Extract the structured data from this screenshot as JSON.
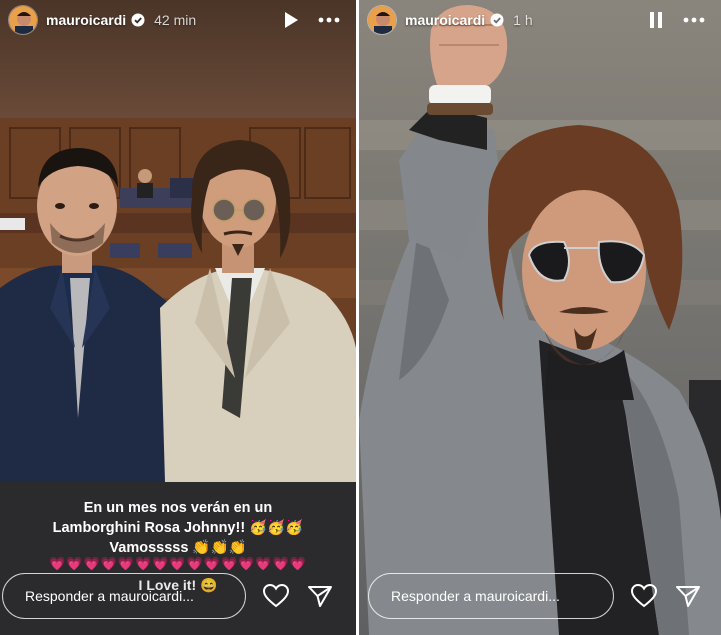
{
  "left_story": {
    "username": "mauroicardi",
    "time": "42 min",
    "caption_lines": [
      "En un mes nos verán en un",
      "Lamborghini Rosa Johnny!! 🥳🥳🥳",
      "Vamosssss 👏👏👏"
    ],
    "hearts": "💗💗💗💗💗💗💗💗💗💗💗💗💗💗💗",
    "tail_text": "I Love it! 😄",
    "reply_placeholder": "Responder a mauroicardi...",
    "icons": [
      "verified-badge-icon",
      "play-icon",
      "more-icon",
      "heart-icon",
      "send-icon"
    ]
  },
  "right_story": {
    "username": "mauroicardi",
    "time": "1 h",
    "reply_placeholder": "Responder a mauroicardi...",
    "icons": [
      "verified-badge-icon",
      "pause-icon",
      "more-icon",
      "heart-icon",
      "send-icon"
    ]
  },
  "colors": {
    "verified": "#3897f0",
    "left_bottom_bg": "#2b2b2e",
    "suit_gray": "#8c8f93"
  }
}
